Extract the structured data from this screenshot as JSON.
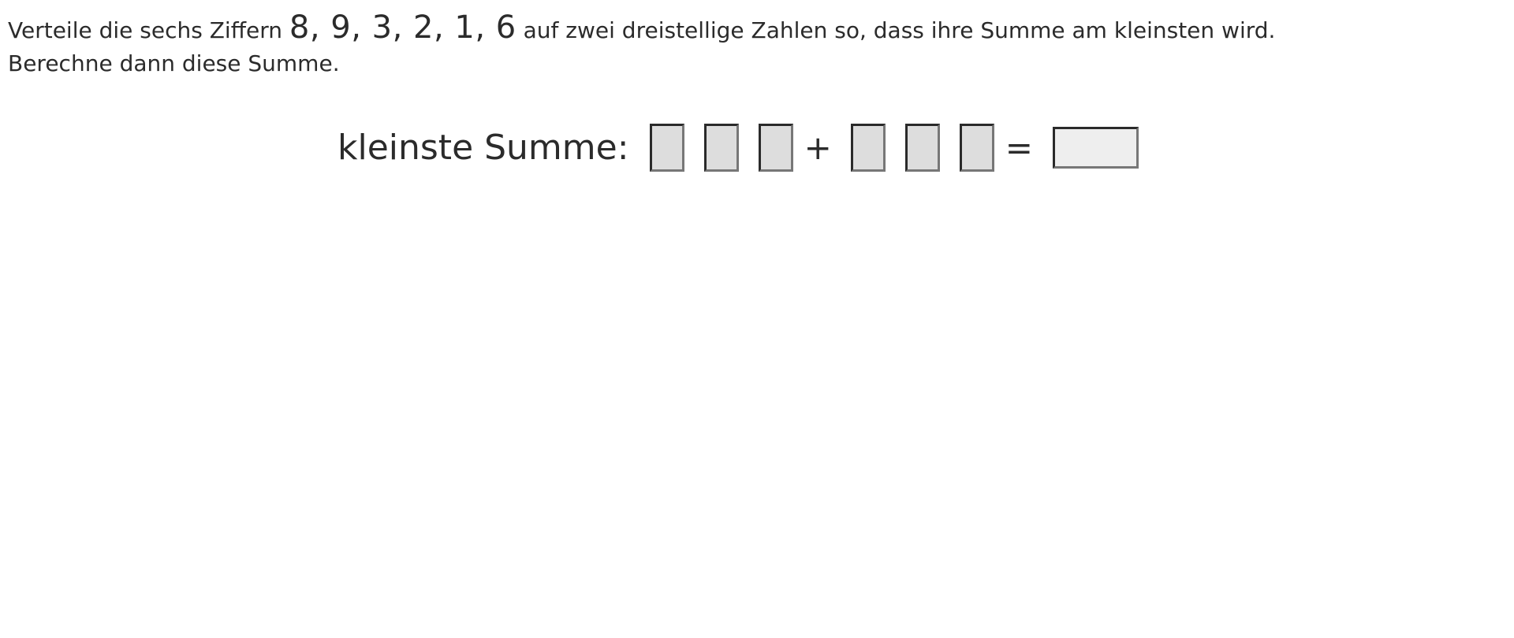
{
  "task": {
    "line1_before": "Verteile die sechs Ziffern ",
    "digits": "8, 9, 3, 2, 1, 6",
    "line1_after": " auf zwei dreistellige Zahlen so, dass ihre Summe am kleinsten wird.",
    "line2": "Berechne dann diese Summe."
  },
  "equation": {
    "label": "kleinste Summe:",
    "plus": "+",
    "equals": "="
  }
}
